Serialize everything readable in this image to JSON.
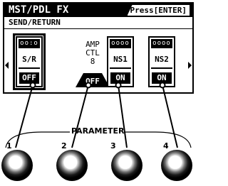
{
  "header": {
    "title": "MST/PDL FX",
    "hint": "Press[ENTER]"
  },
  "subtitle": "SEND/RETURN",
  "slots": [
    {
      "knobs": "oo:o",
      "name": "S/R",
      "state": "OFF"
    },
    {
      "knobs": "oooo",
      "name": "NS1",
      "state": "ON"
    },
    {
      "knobs": "oooo",
      "name": "NS2",
      "state": "ON"
    }
  ],
  "amp": {
    "line1": "AMP",
    "line2": "CTL",
    "line3": "8",
    "state": "OFF"
  },
  "parameter": {
    "label": "PARAMETER",
    "knobs": [
      {
        "number": "1"
      },
      {
        "number": "2"
      },
      {
        "number": "3"
      },
      {
        "number": "4"
      }
    ]
  }
}
